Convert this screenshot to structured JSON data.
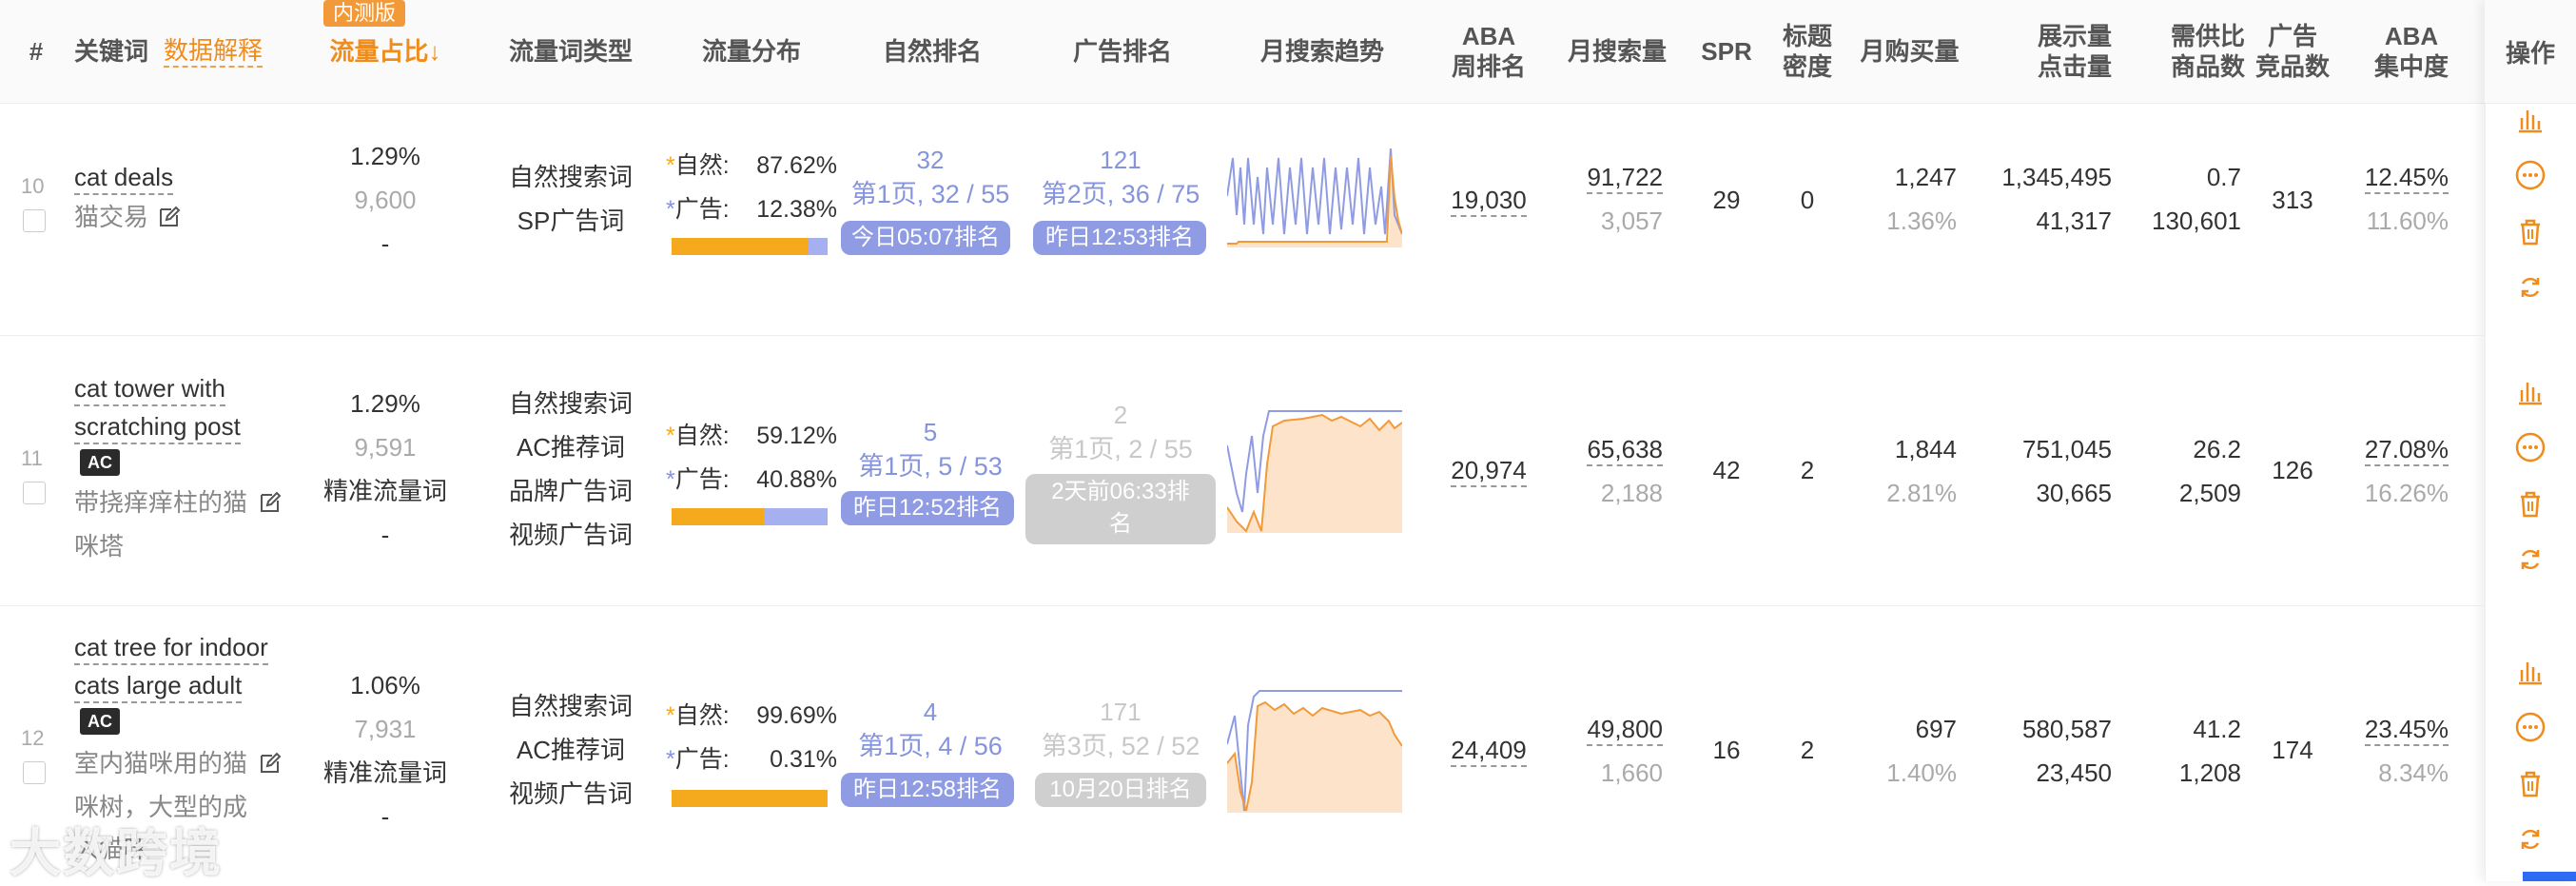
{
  "header": {
    "num": "#",
    "keyword": "关键词",
    "data_explain": "数据解释",
    "beta_badge": "内测版",
    "traffic_share": "流量占比↓",
    "traffic_type": "流量词类型",
    "traffic_dist": "流量分布",
    "organic_rank": "自然排名",
    "ad_rank": "广告排名",
    "monthly_trend": "月搜索趋势",
    "aba_week_1": "ABA",
    "aba_week_2": "周排名",
    "monthly_search": "月搜索量",
    "spr": "SPR",
    "title_density_1": "标题",
    "title_density_2": "密度",
    "monthly_buy": "月购买量",
    "impr_click_1": "展示量",
    "impr_click_2": "点击量",
    "supply_demand_1": "需供比",
    "supply_demand_2": "商品数",
    "ad_comp_1": "广告",
    "ad_comp_2": "竞品数",
    "aba_conc_1": "ABA",
    "aba_conc_2": "集中度",
    "ops": "操作"
  },
  "rows": [
    {
      "num": "10",
      "kw_lines": [
        "cat deals"
      ],
      "ac": "",
      "cn_lines": [
        "猫交易"
      ],
      "share": "1.29%",
      "share_count": "9,600",
      "share_extra": "-",
      "types": [
        "自然搜索词",
        "SP广告词"
      ],
      "natural_label": "自然:",
      "natural_pct": "87.62%",
      "ad_label": "广告:",
      "ad_pct": "12.38%",
      "natural_frac": 0.8762,
      "org_top": "32",
      "org_page": "第1页, 32 / 55",
      "org_time": "今日05:07排名",
      "ad_top": "121",
      "ad_page": "第2页, 36 / 75",
      "ad_time": "昨日12:53排名",
      "aba": "19,030",
      "msearch": "91,722",
      "msearch2": "3,057",
      "spr": "29",
      "density": "0",
      "buy": "1,247",
      "buy_rate": "1.36%",
      "impr": "1,345,495",
      "click": "41,317",
      "sd": "0.7",
      "sd_items": "130,601",
      "adcomp": "313",
      "conc": "12.45%",
      "conc2": "11.60%"
    },
    {
      "num": "11",
      "kw_lines": [
        "cat tower with",
        "scratching post"
      ],
      "ac": "AC",
      "cn_lines": [
        "带挠痒痒柱的猫",
        "咪塔"
      ],
      "share": "1.29%",
      "share_count": "9,591",
      "share_extra": "精准流量词",
      "share_dash": "-",
      "types": [
        "自然搜索词",
        "AC推荐词",
        "品牌广告词",
        "视频广告词"
      ],
      "natural_label": "自然:",
      "natural_pct": "59.12%",
      "ad_label": "广告:",
      "ad_pct": "40.88%",
      "natural_frac": 0.5912,
      "org_top": "5",
      "org_page": "第1页, 5 / 53",
      "org_time": "昨日12:52排名",
      "ad_top": "2",
      "ad_page": "第1页, 2 / 55",
      "ad_time_1": "2天前06:33排",
      "ad_time_2": "名",
      "aba": "20,974",
      "msearch": "65,638",
      "msearch2": "2,188",
      "spr": "42",
      "density": "2",
      "buy": "1,844",
      "buy_rate": "2.81%",
      "impr": "751,045",
      "click": "30,665",
      "sd": "26.2",
      "sd_items": "2,509",
      "adcomp": "126",
      "conc": "27.08%",
      "conc2": "16.26%"
    },
    {
      "num": "12",
      "kw_lines": [
        "cat tree for indoor",
        "cats large adult"
      ],
      "ac": "AC",
      "cn_lines": [
        "室内猫咪用的猫",
        "咪树，大型的成",
        "人猫咪"
      ],
      "share": "1.06%",
      "share_count": "7,931",
      "share_extra": "精准流量词",
      "share_dash": "-",
      "types": [
        "自然搜索词",
        "AC推荐词",
        "视频广告词"
      ],
      "natural_label": "自然:",
      "natural_pct": "99.69%",
      "ad_label": "广告:",
      "ad_pct": "0.31%",
      "natural_frac": 0.9969,
      "org_top": "4",
      "org_page": "第1页, 4 / 56",
      "org_time": "昨日12:58排名",
      "ad_top": "171",
      "ad_page": "第3页, 52 / 52",
      "ad_time": "10月20日排名",
      "aba": "24,409",
      "msearch": "49,800",
      "msearch2": "1,660",
      "spr": "16",
      "density": "2",
      "buy": "697",
      "buy_rate": "1.40%",
      "impr": "580,587",
      "click": "23,450",
      "sd": "41.2",
      "sd_items": "1,208",
      "adcomp": "174",
      "conc": "23.45%",
      "conc2": "8.34%"
    }
  ],
  "watermark": "大数跨境",
  "icons": [
    "bar-chart-icon",
    "more-icon",
    "trash-icon",
    "refresh-icon",
    "edit-icon"
  ],
  "colors": {
    "accent": "#f08c1c",
    "blue": "#8594dc",
    "orange_bar": "#f5a91c"
  }
}
